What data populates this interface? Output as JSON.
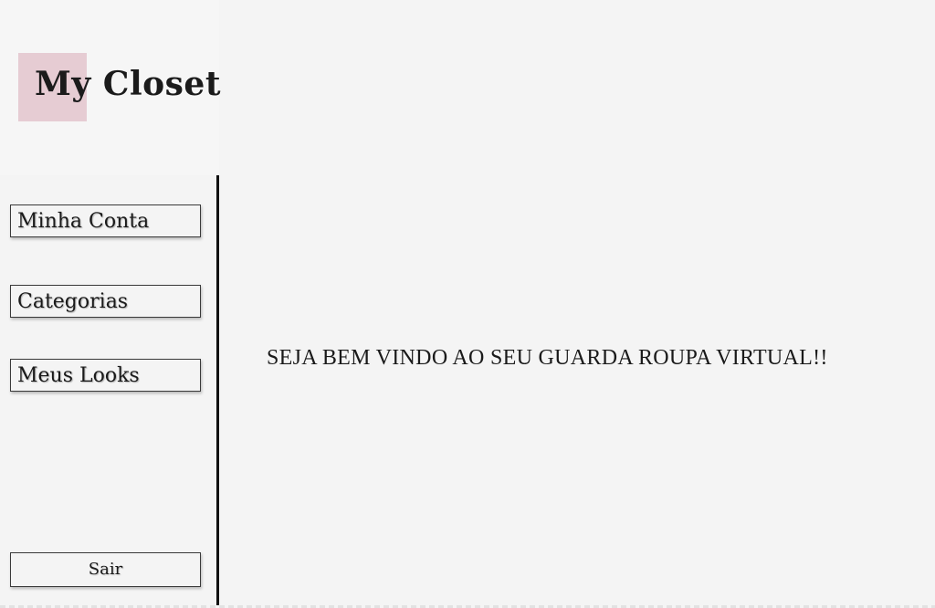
{
  "app": {
    "logo_text": "My Closet",
    "accent_color": "#e6ccd3"
  },
  "sidebar": {
    "items": [
      {
        "label": "Minha Conta"
      },
      {
        "label": "Categorias"
      },
      {
        "label": "Meus Looks"
      }
    ],
    "logout_label": "Sair"
  },
  "main": {
    "welcome_text": "SEJA BEM VINDO AO SEU GUARDA ROUPA VIRTUAL!!"
  }
}
